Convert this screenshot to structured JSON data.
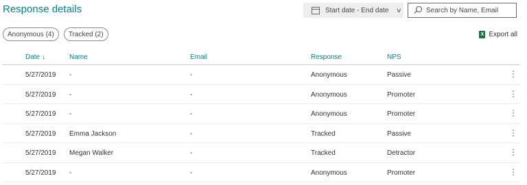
{
  "header": {
    "title": "Response details",
    "date_range_label": "Start date - End date",
    "search_placeholder": "Search by Name, Email"
  },
  "filters": [
    {
      "label": "Anonymous (4)"
    },
    {
      "label": "Tracked (2)"
    }
  ],
  "export_label": "Export all",
  "table": {
    "columns": {
      "date": "Date",
      "name": "Name",
      "email": "Email",
      "response": "Response",
      "nps": "NPS"
    },
    "rows": [
      {
        "date": "5/27/2019",
        "name": "-",
        "email": "-",
        "response": "Anonymous",
        "nps": "Passive"
      },
      {
        "date": "5/27/2019",
        "name": "-",
        "email": "-",
        "response": "Anonymous",
        "nps": "Promoter"
      },
      {
        "date": "5/27/2019",
        "name": "-",
        "email": "-",
        "response": "Anonymous",
        "nps": "Promoter"
      },
      {
        "date": "5/27/2019",
        "name": "Emma Jackson",
        "email": "-",
        "response": "Tracked",
        "nps": "Passive"
      },
      {
        "date": "5/27/2019",
        "name": "Megan Walker",
        "email": "-",
        "response": "Tracked",
        "nps": "Detractor"
      },
      {
        "date": "5/27/2019",
        "name": "-",
        "email": "-",
        "response": "Anonymous",
        "nps": "Promoter"
      }
    ]
  },
  "colors": {
    "accent": "#038387",
    "excel": "#1e7145"
  }
}
